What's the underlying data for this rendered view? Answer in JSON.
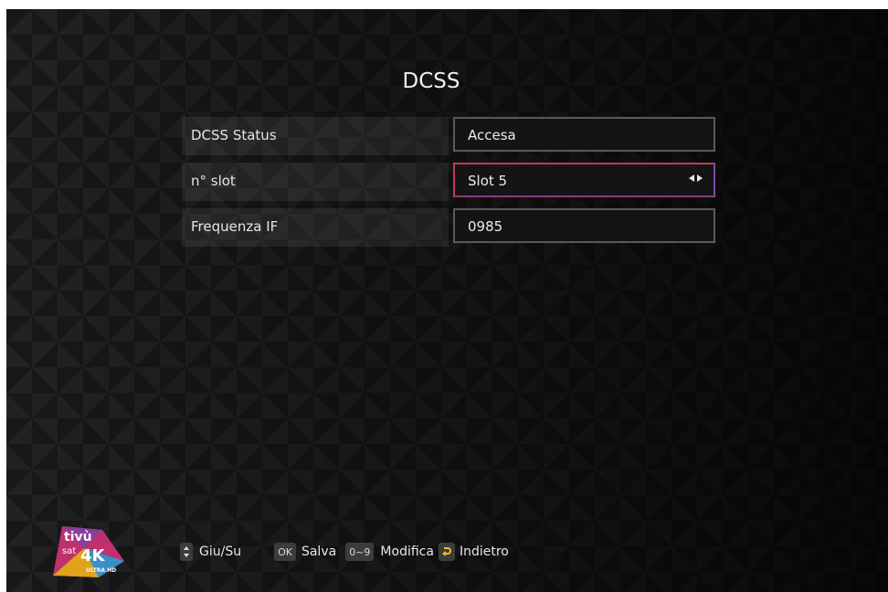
{
  "title": "DCSS",
  "rows": [
    {
      "label": "DCSS Status",
      "value": "Accesa"
    },
    {
      "label": "n° slot",
      "value": "Slot 5"
    },
    {
      "label": "Frequenza IF",
      "value": "0985"
    }
  ],
  "footer": {
    "updown_label": "Giu/Su",
    "ok_key": "OK",
    "ok_label": "Salva",
    "digits_key": "0~9",
    "digits_label": "Modifica",
    "back_label": "Indietro"
  },
  "logo": {
    "text": "tivù sat 4K ULTRA HD"
  },
  "colors": {
    "focus_border": "#c23b55",
    "background": "#181818"
  }
}
